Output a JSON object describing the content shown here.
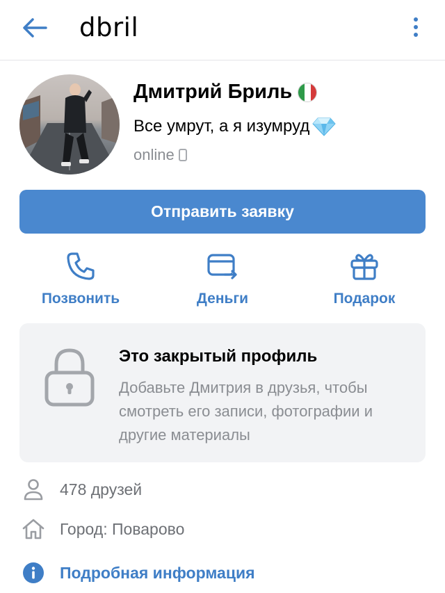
{
  "header": {
    "title": "dbril",
    "back_icon": "arrow-left-icon",
    "menu_icon": "more-vertical-icon"
  },
  "profile": {
    "name": "Дмитрий Бриль",
    "flag_emoji": "italy-flag",
    "status": "Все умрут, а я изумруд",
    "status_emoji": "gem-icon",
    "online": "online",
    "online_device_icon": "phone-icon"
  },
  "request_button": {
    "label": "Отправить заявку"
  },
  "actions": [
    {
      "label": "Позвонить",
      "icon": "phone-call-icon"
    },
    {
      "label": "Деньги",
      "icon": "money-transfer-icon"
    },
    {
      "label": "Подарок",
      "icon": "gift-icon"
    }
  ],
  "private_profile": {
    "title": "Это закрытый профиль",
    "text": "Добавьте Дмитрия в друзья, чтобы смотреть его записи, фотографии и другие материалы",
    "icon": "lock-icon"
  },
  "info": {
    "friends": "478 друзей",
    "city": "Город: Поварово",
    "details": "Подробная информация"
  },
  "colors": {
    "accent": "#4a88cf",
    "link": "#3f7ec6",
    "muted": "#8a8d92",
    "card_bg": "#f2f3f5"
  }
}
